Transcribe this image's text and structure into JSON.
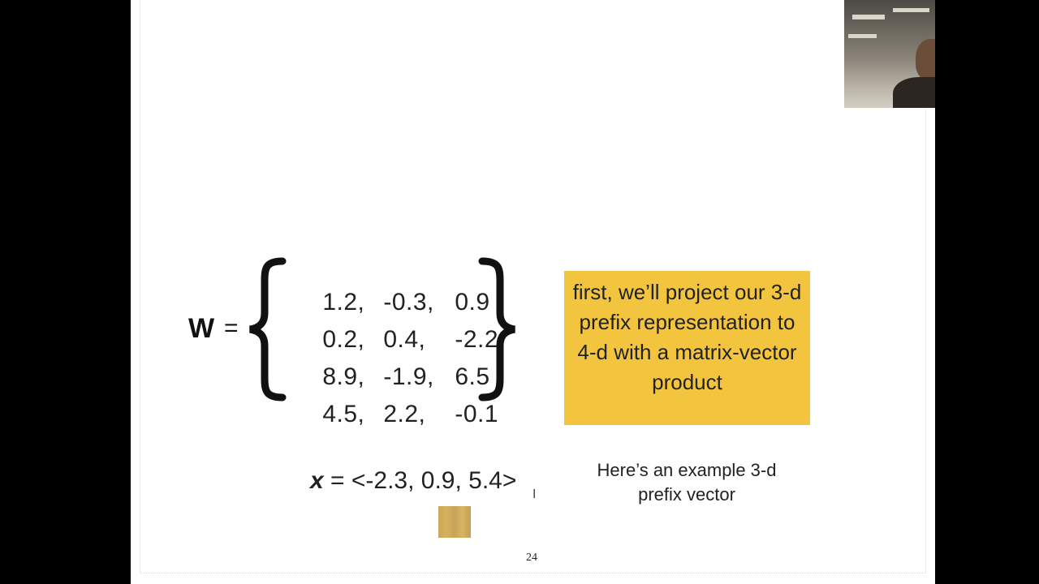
{
  "slide": {
    "matrix_label": "W",
    "equals": "=",
    "matrix_rows": [
      [
        "1.2,",
        "-0.3,",
        "0.9"
      ],
      [
        "0.2,",
        "0.4,",
        "-2.2"
      ],
      [
        "8.9,",
        "-1.9,",
        "6.5"
      ],
      [
        "4.5,",
        "2.2,",
        "-0.1"
      ]
    ],
    "callout_text": "first, we’ll project our 3-d prefix representation to 4-d with a matrix-vector product",
    "vector_var": "x",
    "vector_expr": " = <-2.3, 0.9, 5.4>",
    "example_note": "Here’s an example 3-d prefix vector",
    "page_number": "24",
    "callout_color": "#f3c53e"
  },
  "webcam": {
    "icon": "webcam-video-feed"
  }
}
